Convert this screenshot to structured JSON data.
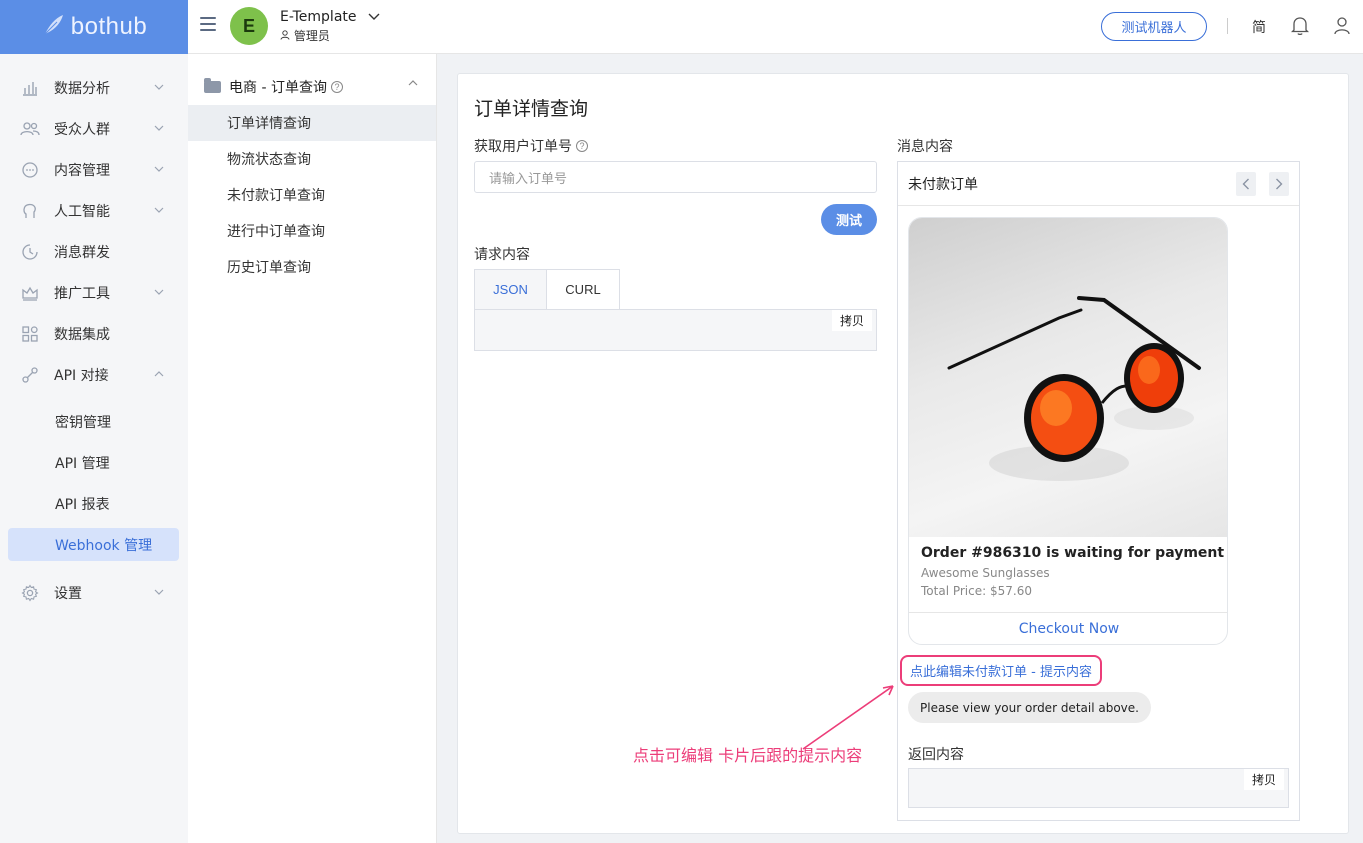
{
  "app": {
    "brand": "bothub"
  },
  "header": {
    "avatar_letter": "E",
    "template_name": "E-Template",
    "role": "管理员",
    "test_bot": "测试机器人",
    "lang": "简"
  },
  "sidebar": {
    "items": [
      {
        "label": "数据分析",
        "icon": "chart-icon",
        "chevron": "down"
      },
      {
        "label": "受众人群",
        "icon": "users-icon",
        "chevron": "down"
      },
      {
        "label": "内容管理",
        "icon": "chat-icon",
        "chevron": "down"
      },
      {
        "label": "人工智能",
        "icon": "brain-icon",
        "chevron": "down"
      },
      {
        "label": "消息群发",
        "icon": "clock-icon",
        "chevron": ""
      },
      {
        "label": "推广工具",
        "icon": "crown-icon",
        "chevron": "down"
      },
      {
        "label": "数据集成",
        "icon": "grid-icon",
        "chevron": ""
      },
      {
        "label": "API 对接",
        "icon": "link-icon",
        "chevron": "up"
      },
      {
        "label": "设置",
        "icon": "gear-icon",
        "chevron": "down"
      }
    ],
    "api_sub": [
      "密钥管理",
      "API 管理",
      "API 报表",
      "Webhook 管理"
    ]
  },
  "subnav": {
    "folder": "电商 - 订单查询",
    "items": [
      "订单详情查询",
      "物流状态查询",
      "未付款订单查询",
      "进行中订单查询",
      "历史订单查询"
    ]
  },
  "main": {
    "title": "订单详情查询",
    "order_label": "获取用户订单号",
    "order_placeholder": "请输入订单号",
    "test_button": "测试",
    "request_label": "请求内容",
    "tabs": [
      "JSON",
      "CURL"
    ],
    "copy": "拷贝",
    "message_label": "消息内容",
    "message_title": "未付款订单",
    "card": {
      "title": "Order #986310 is waiting for payment",
      "subtitle": "Awesome Sunglasses",
      "price": "Total Price: $57.60",
      "action": "Checkout Now"
    },
    "edit_link": "点此编辑未付款订单 - 提示内容",
    "bubble": "Please view your order detail above.",
    "response_label": "返回内容",
    "hint": "点击可编辑 卡片后跟的提示内容"
  },
  "colors": {
    "brand": "#5b8ee6",
    "accent": "#3a6fd8",
    "highlight": "#ec3d79"
  }
}
